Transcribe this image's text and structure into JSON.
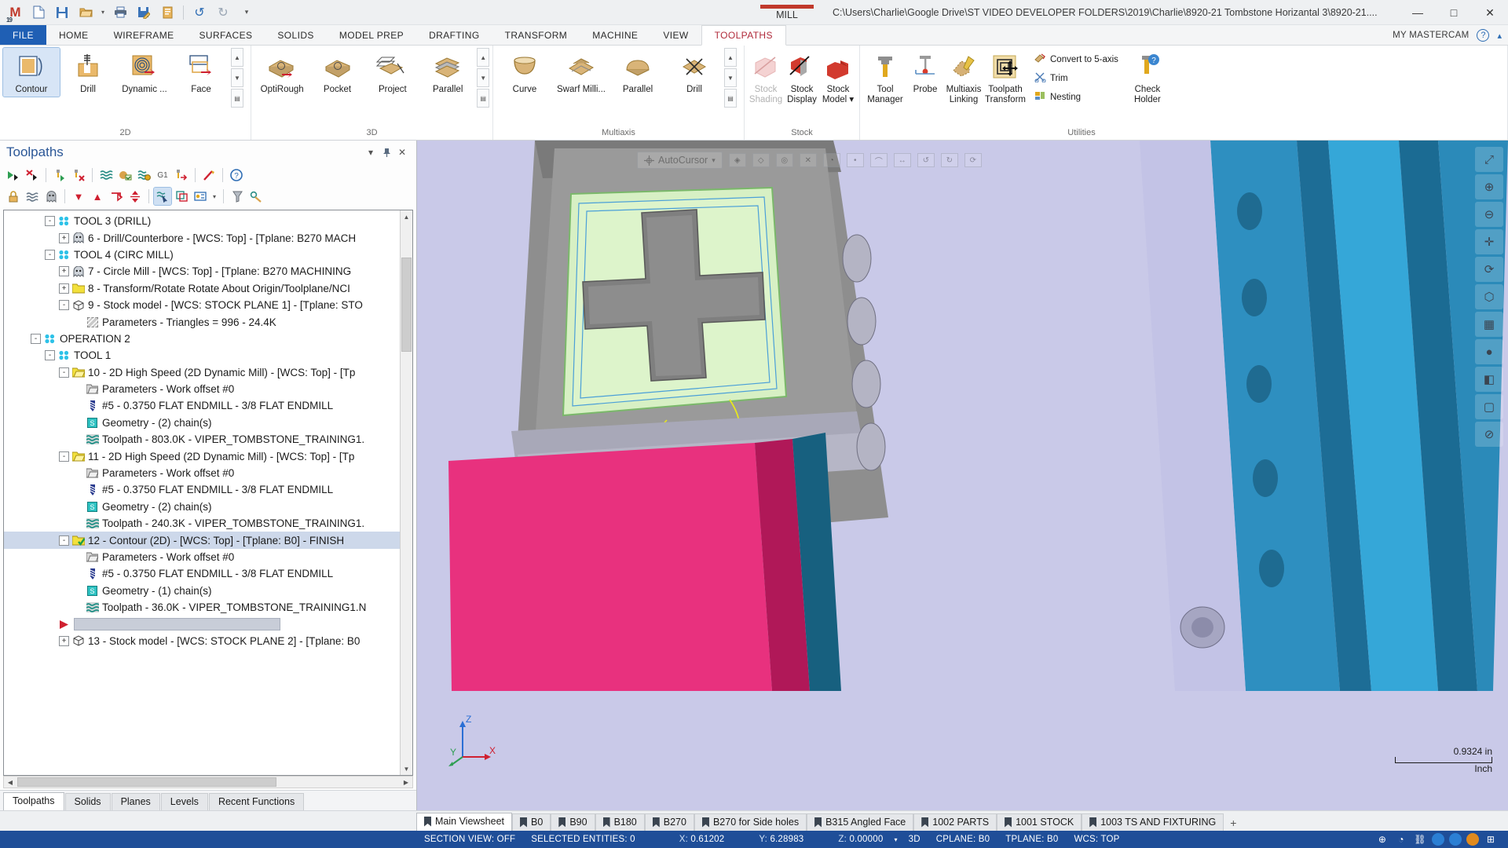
{
  "titlebar": {
    "logo": "M",
    "logo_year": "19",
    "mill_tag": "MILL",
    "document_path": "C:\\Users\\Charlie\\Google Drive\\ST VIDEO DEVELOPER FOLDERS\\2019\\Charlie\\8920-21 Tombstone Horizantal 3\\8920-21....",
    "quick_access": [
      {
        "name": "new-file-icon",
        "glyph": "⬜"
      },
      {
        "name": "save-icon",
        "glyph": "💾"
      },
      {
        "name": "open-folder-icon",
        "glyph": "📁"
      },
      {
        "name": "open-dropdown-icon",
        "glyph": "▾"
      },
      {
        "name": "print-icon",
        "glyph": "🖨"
      },
      {
        "name": "save-as-icon",
        "glyph": "📝"
      },
      {
        "name": "file-properties-icon",
        "glyph": "📒"
      },
      {
        "name": "undo-icon",
        "glyph": "↶"
      },
      {
        "name": "redo-icon",
        "glyph": "↷"
      },
      {
        "name": "customize-qat-icon",
        "glyph": "≡"
      }
    ],
    "window_controls": [
      {
        "name": "minimize-button",
        "glyph": "—"
      },
      {
        "name": "maximize-button",
        "glyph": "□"
      },
      {
        "name": "close-button",
        "glyph": "✕"
      }
    ]
  },
  "ribbon_tabs": [
    {
      "label": "FILE",
      "style": "file"
    },
    {
      "label": "HOME",
      "style": ""
    },
    {
      "label": "WIREFRAME",
      "style": ""
    },
    {
      "label": "SURFACES",
      "style": ""
    },
    {
      "label": "SOLIDS",
      "style": ""
    },
    {
      "label": "MODEL PREP",
      "style": ""
    },
    {
      "label": "DRAFTING",
      "style": ""
    },
    {
      "label": "TRANSFORM",
      "style": ""
    },
    {
      "label": "MACHINE",
      "style": ""
    },
    {
      "label": "VIEW",
      "style": ""
    },
    {
      "label": "TOOLPATHS",
      "style": "active"
    }
  ],
  "tab_right": {
    "my_mastercam": "MY MASTERCAM",
    "help": "?",
    "collapse": "▴"
  },
  "ribbon_groups": [
    {
      "name": "2D",
      "buttons": [
        {
          "label": "Contour",
          "icon": "contour-icon",
          "selected": true
        },
        {
          "label": "Drill",
          "icon": "drill-icon",
          "selected": false
        },
        {
          "label": "Dynamic ...",
          "icon": "dynamic-mill-icon",
          "selected": false
        },
        {
          "label": "Face",
          "icon": "face-icon",
          "selected": false
        }
      ]
    },
    {
      "name": "3D",
      "buttons": [
        {
          "label": "OptiRough",
          "icon": "optirough-icon",
          "selected": false
        },
        {
          "label": "Pocket",
          "icon": "pocket-3d-icon",
          "selected": false
        },
        {
          "label": "Project",
          "icon": "project-icon",
          "selected": false
        },
        {
          "label": "Parallel",
          "icon": "parallel-3d-icon",
          "selected": false
        }
      ]
    },
    {
      "name": "Multiaxis",
      "buttons": [
        {
          "label": "Curve",
          "icon": "curve-icon",
          "selected": false
        },
        {
          "label": "Swarf Milli...",
          "icon": "swarf-milling-icon",
          "selected": false
        },
        {
          "label": "Parallel",
          "icon": "parallel-multiaxis-icon",
          "selected": false
        },
        {
          "label": "Drill",
          "icon": "drill-multiaxis-icon",
          "selected": false
        }
      ]
    },
    {
      "name": "Stock",
      "buttons": [
        {
          "label": "Stock Shading",
          "icon": "stock-shading-icon",
          "disabled": true
        },
        {
          "label": "Stock Display",
          "icon": "stock-display-icon",
          "disabled": false
        },
        {
          "label": "Stock Model ▾",
          "icon": "stock-model-icon",
          "disabled": false
        }
      ]
    },
    {
      "name": "Utilities",
      "buttons": [
        {
          "label": "Tool Manager",
          "icon": "tool-manager-icon"
        },
        {
          "label": "Probe",
          "icon": "probe-icon"
        },
        {
          "label": "Multiaxis Linking",
          "icon": "multiaxis-linking-icon"
        },
        {
          "label": "Toolpath Transform",
          "icon": "toolpath-transform-icon"
        }
      ],
      "small_buttons": [
        {
          "label": "Convert to 5-axis",
          "icon": "convert-5axis-icon"
        },
        {
          "label": "Trim",
          "icon": "trim-icon"
        },
        {
          "label": "Nesting",
          "icon": "nesting-icon"
        }
      ],
      "check_holder": {
        "label": "Check Holder",
        "icon": "check-holder-icon"
      }
    }
  ],
  "toolpaths_panel": {
    "title": "Toolpaths",
    "header_buttons": [
      {
        "name": "panel-dropdown-button",
        "glyph": "▾"
      },
      {
        "name": "panel-pin-button",
        "glyph": "📌"
      },
      {
        "name": "panel-close-button",
        "glyph": "✕"
      }
    ],
    "toolbar_row1": [
      {
        "name": "select-all-toolpaths-icon",
        "glyph": "▶"
      },
      {
        "name": "deselect-all-toolpaths-icon",
        "glyph": "✖"
      },
      {
        "name": "regenerate-selected-icon",
        "glyph": "▶"
      },
      {
        "name": "regenerate-invalid-icon",
        "glyph": "✖"
      },
      {
        "name": "backplot-selected-icon",
        "glyph": "≈"
      },
      {
        "name": "verify-selected-icon",
        "glyph": "◉"
      },
      {
        "name": "simulate-icon",
        "glyph": "≈"
      },
      {
        "name": "g1-post-icon",
        "glyph": "G1"
      },
      {
        "name": "post-selected-icon",
        "glyph": "↦"
      },
      {
        "name": "high-feed-icon",
        "glyph": "✐"
      },
      {
        "name": "help-icon",
        "glyph": "?"
      }
    ],
    "toolbar_row2": [
      {
        "name": "lock-selected-icon",
        "glyph": "🔒"
      },
      {
        "name": "toggle-posting-icon",
        "glyph": "≈"
      },
      {
        "name": "toggle-display-icon",
        "glyph": "👻"
      },
      {
        "name": "move-down-icon",
        "glyph": "▼"
      },
      {
        "name": "move-up-icon",
        "glyph": "▲"
      },
      {
        "name": "move-insert-arrow-icon",
        "glyph": "↳"
      },
      {
        "name": "expand-collapse-icon",
        "glyph": "⇅"
      },
      {
        "name": "select-geometry-icon",
        "glyph": "➤"
      },
      {
        "name": "toggle-tree-icon",
        "glyph": "⧉"
      },
      {
        "name": "machine-group-icon",
        "glyph": "▤"
      },
      {
        "name": "machine-group-dropdown-icon",
        "glyph": "▾"
      },
      {
        "name": "filter-icon",
        "glyph": "⧖"
      },
      {
        "name": "settings-icon",
        "glyph": "⚙"
      }
    ],
    "tree": [
      {
        "indent": 2,
        "expander": "-",
        "icon": "tool-group-icon",
        "label": "TOOL 3 (DRILL)",
        "selected": false
      },
      {
        "indent": 3,
        "expander": "+",
        "icon": "operation-icon",
        "label": "6 - Drill/Counterbore - [WCS: Top] - [Tplane: B270 MACH",
        "selected": false
      },
      {
        "indent": 2,
        "expander": "-",
        "icon": "tool-group-icon",
        "label": "TOOL 4 (CIRC MILL)",
        "selected": false
      },
      {
        "indent": 3,
        "expander": "+",
        "icon": "operation-icon",
        "label": "7 - Circle Mill - [WCS: Top] - [Tplane: B270 MACHINING",
        "selected": false
      },
      {
        "indent": 3,
        "expander": "+",
        "icon": "yellow-folder-icon",
        "label": "8 - Transform/Rotate Rotate About Origin/Toolplane/NCI",
        "selected": false
      },
      {
        "indent": 3,
        "expander": "-",
        "icon": "stock-model-tree-icon",
        "label": "9 - Stock model - [WCS: STOCK PLANE 1] - [Tplane: STO",
        "selected": false
      },
      {
        "indent": 4,
        "expander": "",
        "icon": "parameters-hatch-icon",
        "label": "Parameters - Triangles =  996 - 24.4K",
        "selected": false
      },
      {
        "indent": 1,
        "expander": "-",
        "icon": "tool-group-icon",
        "label": "OPERATION 2",
        "selected": false
      },
      {
        "indent": 2,
        "expander": "-",
        "icon": "tool-group-icon",
        "label": "TOOL 1",
        "selected": false
      },
      {
        "indent": 3,
        "expander": "-",
        "icon": "yellow-folder-open-icon",
        "label": "10 - 2D High Speed (2D Dynamic Mill) - [WCS: Top] - [Tp",
        "selected": false
      },
      {
        "indent": 4,
        "expander": "",
        "icon": "parameters-folder-icon",
        "label": "Parameters - Work offset #0",
        "selected": false
      },
      {
        "indent": 4,
        "expander": "",
        "icon": "endmill-icon",
        "label": "#5 - 0.3750 FLAT ENDMILL - 3/8 FLAT ENDMILL",
        "selected": false
      },
      {
        "indent": 4,
        "expander": "",
        "icon": "geometry-icon",
        "label": "Geometry - (2) chain(s)",
        "selected": false
      },
      {
        "indent": 4,
        "expander": "",
        "icon": "toolpath-wave-icon",
        "label": "Toolpath - 803.0K - VIPER_TOMBSTONE_TRAINING1.",
        "selected": false
      },
      {
        "indent": 3,
        "expander": "-",
        "icon": "yellow-folder-open-icon",
        "label": "11 - 2D High Speed (2D Dynamic Mill) - [WCS: Top] - [Tp",
        "selected": false
      },
      {
        "indent": 4,
        "expander": "",
        "icon": "parameters-folder-icon",
        "label": "Parameters - Work offset #0",
        "selected": false
      },
      {
        "indent": 4,
        "expander": "",
        "icon": "endmill-icon",
        "label": "#5 - 0.3750 FLAT ENDMILL - 3/8 FLAT ENDMILL",
        "selected": false
      },
      {
        "indent": 4,
        "expander": "",
        "icon": "geometry-icon",
        "label": "Geometry - (2) chain(s)",
        "selected": false
      },
      {
        "indent": 4,
        "expander": "",
        "icon": "toolpath-wave-icon",
        "label": "Toolpath - 240.3K - VIPER_TOMBSTONE_TRAINING1.",
        "selected": false
      },
      {
        "indent": 3,
        "expander": "-",
        "icon": "yellow-folder-check-icon",
        "label": "12 - Contour (2D) - [WCS: Top] - [Tplane: B0] - FINISH",
        "selected": true
      },
      {
        "indent": 4,
        "expander": "",
        "icon": "parameters-folder-icon",
        "label": "Parameters - Work offset #0",
        "selected": false
      },
      {
        "indent": 4,
        "expander": "",
        "icon": "endmill-icon",
        "label": "#5 - 0.3750 FLAT ENDMILL - 3/8 FLAT ENDMILL",
        "selected": false
      },
      {
        "indent": 4,
        "expander": "",
        "icon": "geometry-icon",
        "label": "Geometry - (1) chain(s)",
        "selected": false
      },
      {
        "indent": 4,
        "expander": "",
        "icon": "toolpath-wave-icon",
        "label": "Toolpath - 36.0K - VIPER_TOMBSTONE_TRAINING1.N",
        "selected": false
      },
      {
        "indent": 2,
        "expander": "",
        "icon": "insert-arrow-icon",
        "label": "",
        "selected": false,
        "progress": true
      },
      {
        "indent": 3,
        "expander": "+",
        "icon": "stock-model-tree-icon",
        "label": "13 - Stock model - [WCS: STOCK PLANE 2] - [Tplane: B0",
        "selected": false
      }
    ],
    "bottom_tabs": [
      {
        "label": "Toolpaths",
        "active": true
      },
      {
        "label": "Solids",
        "active": false
      },
      {
        "label": "Planes",
        "active": false
      },
      {
        "label": "Levels",
        "active": false
      },
      {
        "label": "Recent Functions",
        "active": false
      }
    ]
  },
  "viewport": {
    "autocursor": {
      "label": "AutoCursor",
      "dropdown": "▾",
      "buttons": [
        "⊕",
        "⊙",
        "▭",
        "◆",
        "△",
        "◎",
        "⬚",
        "↻",
        "↺",
        "⟳"
      ]
    },
    "right_toolbar": [
      {
        "name": "fit-view-icon",
        "glyph": "⤢"
      },
      {
        "name": "zoom-window-icon",
        "glyph": "⊕"
      },
      {
        "name": "zoom-out-icon",
        "glyph": "⊖"
      },
      {
        "name": "pan-icon",
        "glyph": "✚"
      },
      {
        "name": "dynamic-rotate-icon",
        "glyph": "⟳"
      },
      {
        "name": "isometric-view-icon",
        "glyph": "⬡"
      },
      {
        "name": "wireframe-view-icon",
        "glyph": "▦"
      },
      {
        "name": "shaded-view-icon",
        "glyph": "●"
      },
      {
        "name": "section-view-icon",
        "glyph": "◧"
      },
      {
        "name": "blank-entities-icon",
        "glyph": "□"
      },
      {
        "name": "hide-entities-icon",
        "glyph": "⊘"
      }
    ],
    "axis": {
      "x": "X",
      "y": "Y",
      "z": "Z"
    },
    "scale_value": "0.9324 in",
    "scale_unit": "Inch"
  },
  "viewsheets": [
    {
      "label": "Main Viewsheet",
      "active": true
    },
    {
      "label": "B0",
      "active": false
    },
    {
      "label": "B90",
      "active": false
    },
    {
      "label": "B180",
      "active": false
    },
    {
      "label": "B270",
      "active": false
    },
    {
      "label": "B270 for  Side holes",
      "active": false
    },
    {
      "label": "B315 Angled Face",
      "active": false
    },
    {
      "label": "1002 PARTS",
      "active": false
    },
    {
      "label": "1001 STOCK",
      "active": false
    },
    {
      "label": "1003 TS AND FIXTURING",
      "active": false
    }
  ],
  "viewsheet_add": "+",
  "statusbar": {
    "section_view": "SECTION VIEW: OFF",
    "selected_entities": "SELECTED ENTITIES: 0",
    "x_label": "X:",
    "x_value": "0.61202",
    "y_label": "Y:",
    "y_value": "6.28983",
    "z_label": "Z:",
    "z_value": "0.00000",
    "z_dropdown": "▾",
    "mode": "3D",
    "cplane": "CPLANE: B0",
    "tplane": "TPLANE: B0",
    "wcs": "WCS: TOP",
    "icons": [
      {
        "name": "globe-icon",
        "glyph": "⊕"
      },
      {
        "name": "clock-icon",
        "glyph": "◔"
      },
      {
        "name": "link-icon",
        "glyph": "⚭"
      },
      {
        "name": "blue-dot-1-icon",
        "glyph": ""
      },
      {
        "name": "blue-dot-2-icon",
        "glyph": ""
      },
      {
        "name": "orange-dot-icon",
        "glyph": ""
      },
      {
        "name": "grid-icon",
        "glyph": "⊞"
      }
    ]
  },
  "colors": {
    "accent_blue": "#1f4e98",
    "file_tab": "#1f5fb4",
    "mill_red": "#c0392b",
    "tree_selected": "#cdd8ea",
    "viewport_bg": "#c9c9e8",
    "part_pink": "#e8317e",
    "part_green": "#d4f0c0",
    "part_gray": "#8a8a8a",
    "part_blue": "#1f7fb4"
  }
}
